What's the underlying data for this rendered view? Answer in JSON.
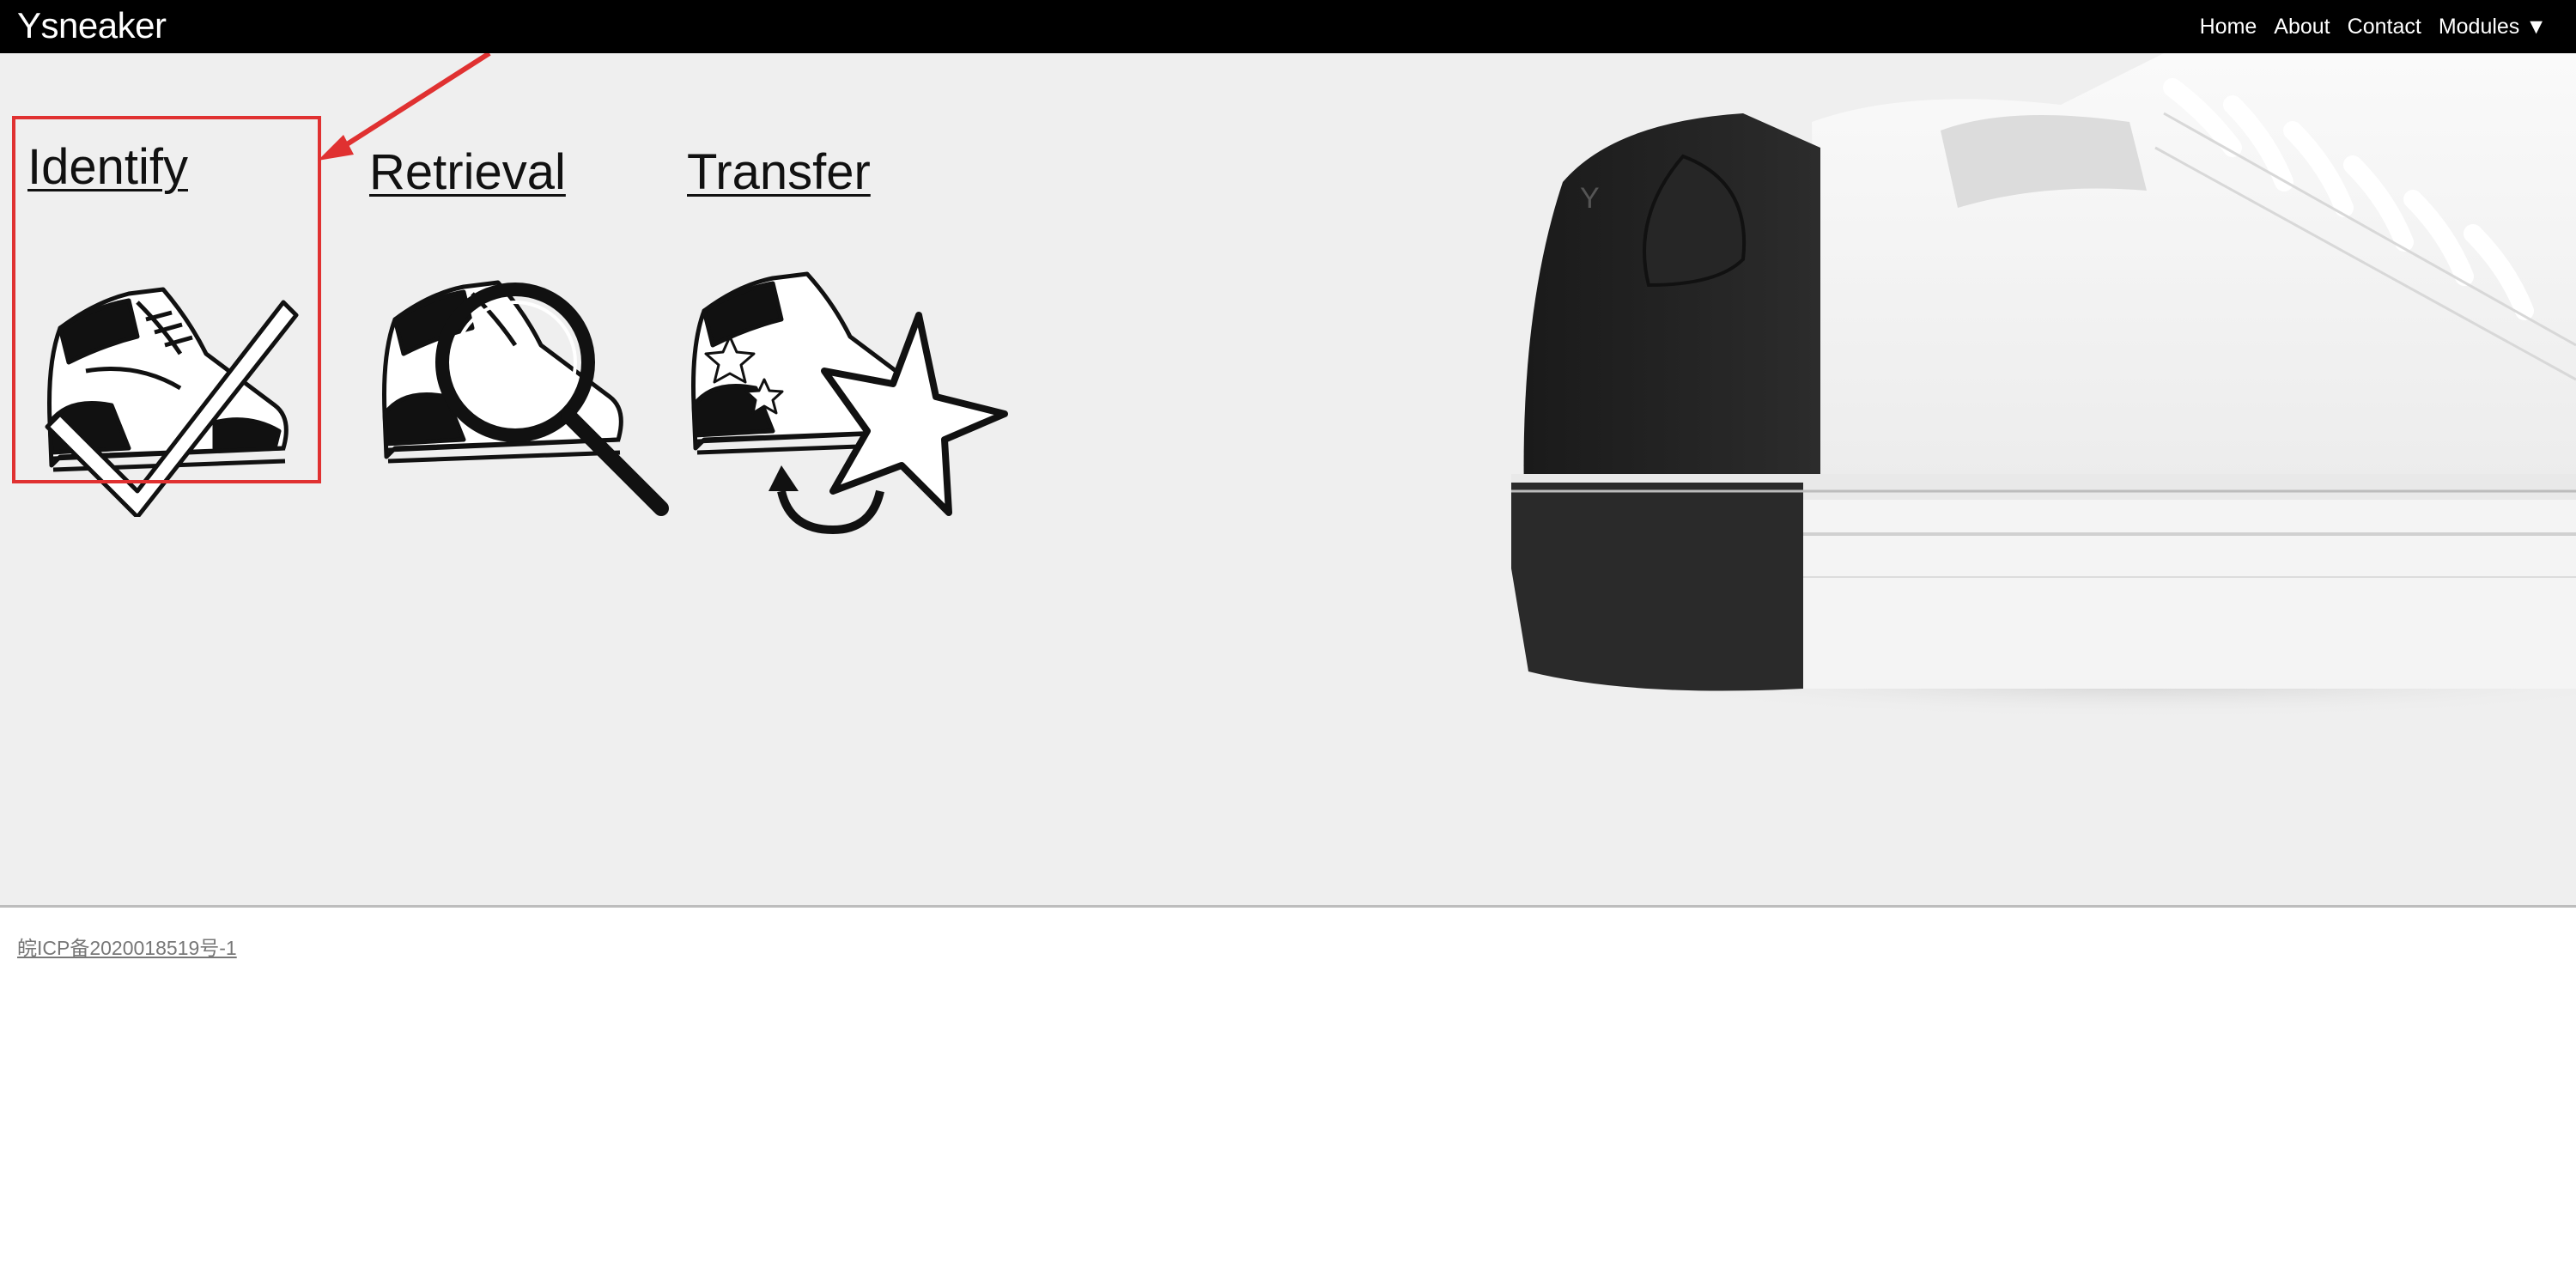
{
  "navbar": {
    "brand": "Ysneaker",
    "links": [
      {
        "label": "Home"
      },
      {
        "label": "About"
      },
      {
        "label": "Contact"
      },
      {
        "label": "Modules ▼"
      }
    ]
  },
  "modules": [
    {
      "title": "Identify",
      "icon": "sneaker-check-icon"
    },
    {
      "title": "Retrieval",
      "icon": "sneaker-magnifier-icon"
    },
    {
      "title": "Transfer",
      "icon": "sneaker-star-transfer-icon"
    }
  ],
  "annotation": {
    "color": "#e03131",
    "target": "Identify"
  },
  "hero": {
    "image": "white-sneaker-black-heel-photo"
  },
  "footer": {
    "icp": "皖ICP备2020018519号-1"
  },
  "colors": {
    "navbar": "#000000",
    "hero_bg": "#efefef",
    "highlight": "#e03131"
  }
}
